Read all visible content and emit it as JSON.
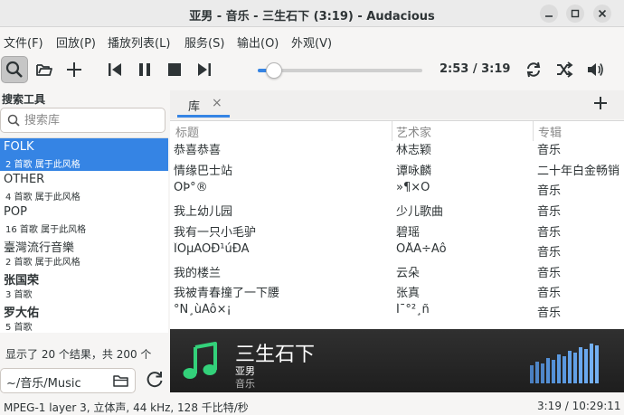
{
  "window": {
    "title": "亚男 - 音乐 - 三生石下 (3:19) - Audacious"
  },
  "menu": [
    "文件(F)",
    "回放(P)",
    "播放列表(L)",
    "服务(S)",
    "输出(O)",
    "外观(V)"
  ],
  "player": {
    "time": "2:53 / 3:19",
    "progress": 0.1
  },
  "search_panel": {
    "title": "搜索工具",
    "placeholder": "搜索库",
    "results": [
      {
        "name": "FOLK",
        "sub": "2 首歌 属于此风格"
      },
      {
        "name": "OTHER",
        "sub": "4 首歌 属于此风格"
      },
      {
        "name": "POP",
        "sub": "16 首歌 属于此风格"
      },
      {
        "name": "臺灣流行音樂",
        "sub": "2 首歌 属于此风格"
      },
      {
        "name": "张国荣",
        "sub": "3 首歌"
      },
      {
        "name": "罗大佑",
        "sub": "5 首歌"
      }
    ],
    "result_count": "显示了 20 个结果，共 200 个",
    "path": "~/音乐/Music"
  },
  "playlist": {
    "tab_label": "库",
    "tab_close": "×",
    "headers": [
      "标题",
      "艺术家",
      "专辑"
    ],
    "rows": [
      [
        "恭喜恭喜",
        "林志颖",
        "音乐"
      ],
      [
        "情缘巴士站",
        "谭咏麟",
        "二十年白金畅销"
      ],
      [
        "ÓÞ°®",
        "»¶×Ó",
        "音乐"
      ],
      [
        "我上幼儿园",
        "少儿歌曲",
        "音乐"
      ],
      [
        "我有一只小毛驴",
        "碧瑶",
        "音乐"
      ],
      [
        "ÎÒµÄÖÐ¹úÐÄ",
        "ÕÅÃ÷Ãô",
        "音乐"
      ],
      [
        "我的楼兰",
        "云朵",
        "音乐"
      ],
      [
        "我被青春撞了一下腰",
        "张真",
        "音乐"
      ],
      [
        "°Ñ¸ùÁô×¡",
        "Í¯°²¸ñ",
        "音乐"
      ]
    ]
  },
  "now_playing": {
    "title": "三生石下",
    "artist": "亚男",
    "album": "音乐"
  },
  "status": {
    "format": "MPEG-1 layer 3, 立体声, 44 kHz, 128 千比特/秒",
    "time": "3:19 / 10:29:11"
  },
  "colors": {
    "accent": "#3584e4",
    "now_playing_icon": "#33d17a",
    "visualizer": "#5e9be0"
  },
  "icons": [
    "search-icon",
    "folder-open-icon",
    "add-icon",
    "previous-icon",
    "pause-icon",
    "stop-icon",
    "next-icon",
    "repeat-icon",
    "shuffle-icon",
    "volume-icon",
    "music-note-icon",
    "refresh-icon"
  ]
}
